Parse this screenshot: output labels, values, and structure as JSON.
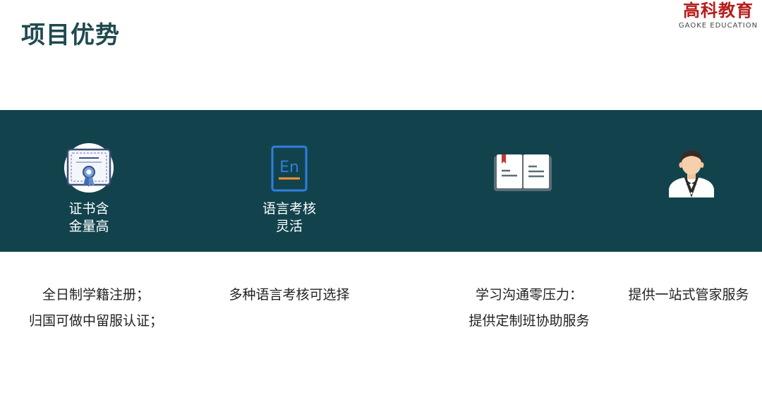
{
  "header": {
    "title": "项目优势",
    "logo_cn": "高科教育",
    "logo_en": "GAOKE EDUCATION"
  },
  "features": [
    {
      "icon": "certificate-icon",
      "label_line1": "证书含",
      "label_line2": "金量高"
    },
    {
      "icon": "language-en-icon",
      "label_line1": "语言考核",
      "label_line2": "灵活"
    },
    {
      "icon": "open-book-icon",
      "label_line1": "",
      "label_line2": ""
    },
    {
      "icon": "butler-icon",
      "label_line1": "",
      "label_line2": ""
    }
  ],
  "descriptions": [
    {
      "line1": "全日制学籍注册；",
      "line2": "归国可做中留服认证；"
    },
    {
      "line1": "多种语言考核可选择",
      "line2": ""
    },
    {
      "line1": "学习沟通零压力：",
      "line2": "提供定制班协助服务"
    },
    {
      "line1": "提供一站式管家服务",
      "line2": ""
    }
  ],
  "colors": {
    "title": "#1f4a4f",
    "band": "#12434d",
    "logo": "#b71c1c",
    "icon_blue": "#2e7fe0",
    "icon_orange": "#f0962e"
  }
}
